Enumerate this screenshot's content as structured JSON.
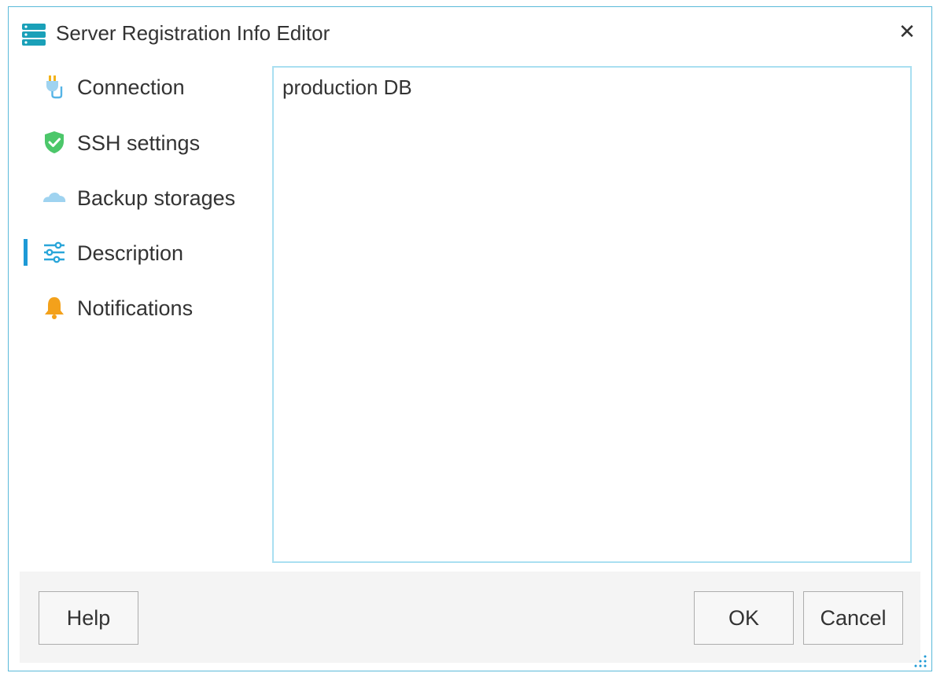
{
  "window": {
    "title": "Server Registration Info Editor",
    "close_glyph": "✕",
    "app_icon": "server-stack-icon"
  },
  "sidebar": {
    "items": [
      {
        "label": "Connection",
        "icon": "plug-icon",
        "active": false
      },
      {
        "label": "SSH settings",
        "icon": "shield-check-icon",
        "active": false
      },
      {
        "label": "Backup storages",
        "icon": "cloud-icon",
        "active": false
      },
      {
        "label": "Description",
        "icon": "sliders-icon",
        "active": true
      },
      {
        "label": "Notifications",
        "icon": "bell-icon",
        "active": false
      }
    ]
  },
  "description": {
    "value": "production DB"
  },
  "footer": {
    "help_label": "Help",
    "ok_label": "OK",
    "cancel_label": "Cancel"
  },
  "colors": {
    "accent": "#1e9ad6",
    "border": "#5ab9d9",
    "textarea_border": "#a9dff1",
    "footer_bg": "#f4f4f4"
  }
}
